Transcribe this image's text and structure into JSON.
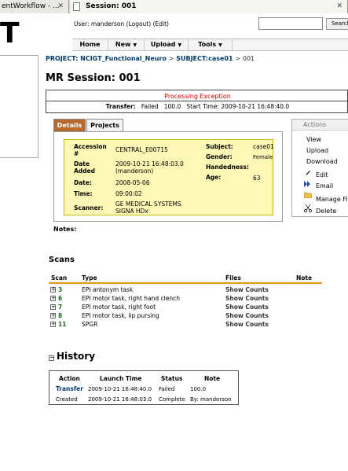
{
  "browser": {
    "tabs": [
      {
        "label": "entWorkflow - ...",
        "close": "✕"
      },
      {
        "label": "Session: 001",
        "close": "✕"
      }
    ]
  },
  "logo": {
    "text": "T"
  },
  "userbar": {
    "user_prefix": "User: manderson",
    "logout": "(Logout)",
    "edit": "(Edit)"
  },
  "search": {
    "button_label": "Search",
    "value": ""
  },
  "menu": {
    "items": [
      "Home",
      "New",
      "Upload",
      "Tools"
    ]
  },
  "breadcrumb": {
    "project_label": "PROJECT: NCIGT_Functional_Neuro",
    "sep": ">",
    "subject_label": "SUBJECT:case01",
    "session": "001"
  },
  "page_title": "MR Session: 001",
  "processing": {
    "title": "Processing Exception",
    "transfer_label": "Transfer:",
    "status": "Failed",
    "percent": "100.0",
    "start_label": "Start Time:",
    "start_time": "2009-10-21 16:48:40.0"
  },
  "detail_tabs": [
    "Details",
    "Projects"
  ],
  "details": {
    "accession_label": "Accession #",
    "accession": "CENTRAL_E00715",
    "date_added_label": "Date Added",
    "date_added": "2009-10-21 16:48:03.0",
    "added_by": "(manderson)",
    "date_label": "Date:",
    "date": "2008-05-06",
    "time_label": "Time:",
    "time": "09:00:02",
    "scanner_label": "Scanner:",
    "scanner_1": "GE MEDICAL SYSTEMS",
    "scanner_2": "SIGNA HDx",
    "subject_label": "Subject:",
    "subject": "case01",
    "gender_label": "Gender:",
    "gender": "Female",
    "handedness_label": "Handedness:",
    "handedness": "",
    "age_label": "Age:",
    "age": "63"
  },
  "actions": {
    "title": "Actions",
    "items": [
      "View",
      "Upload",
      "Download",
      "Edit",
      "Email",
      "Manage Fi",
      "Delete"
    ]
  },
  "notes_label": "Notes:",
  "scans": {
    "title": "Scans",
    "headers": [
      "Scan",
      "Type",
      "Files",
      "Note"
    ],
    "toggle": "+",
    "rows": [
      {
        "id": "3",
        "type": "EPI antonym task",
        "files": "Show Counts"
      },
      {
        "id": "6",
        "type": "EPI motor task, right hand clench",
        "files": "Show Counts"
      },
      {
        "id": "7",
        "type": "EPI motor task, right foot",
        "files": "Show Counts"
      },
      {
        "id": "8",
        "type": "EPI motor task, lip pursing",
        "files": "Show Counts"
      },
      {
        "id": "11",
        "type": "SPGR",
        "files": "Show Counts"
      }
    ]
  },
  "history": {
    "toggle": "−",
    "title": "History",
    "headers": [
      "Action",
      "Launch Time",
      "Status",
      "Note"
    ],
    "rows": [
      {
        "action": "Transfer",
        "time": "2009-10-21 16:48:40.0",
        "status": "Failed",
        "note": "100.0"
      },
      {
        "action": "Created",
        "time": "2009-10-21 16:48:03.0",
        "status": "Complete",
        "note": "By: manderson"
      }
    ]
  },
  "colors": {
    "accent_orange": "#e7962b",
    "tab_active": "#b66a2e",
    "details_bg": "#fdf8b5",
    "error_red": "#cc0000",
    "link_blue": "#003a6c",
    "scan_id_green": "#1a6b1a"
  }
}
